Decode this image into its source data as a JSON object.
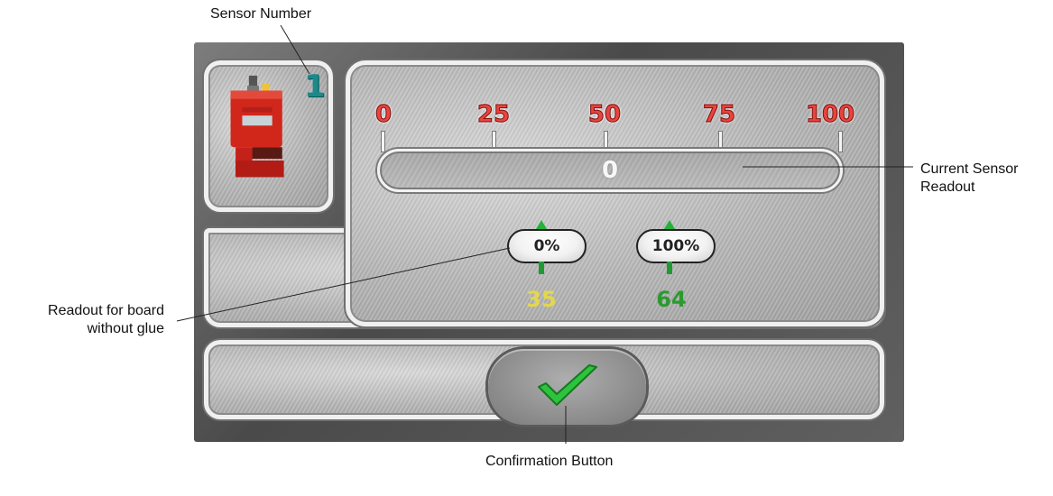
{
  "annotations": {
    "sensor_number": "Sensor Number",
    "current_readout": "Current Sensor\nReadout",
    "readout_no_glue": "Readout for board\nwithout glue",
    "confirm_button": "Confirmation Button"
  },
  "sensor": {
    "number": "1",
    "icon": "sensor-device-icon"
  },
  "scale": {
    "ticks": [
      "0",
      "25",
      "50",
      "75",
      "100"
    ]
  },
  "current_readout": "0",
  "calibration": {
    "low": {
      "label": "0%",
      "value": "35",
      "color": "#e3d74b"
    },
    "high": {
      "label": "100%",
      "value": "64",
      "color": "#2a9a2e"
    }
  },
  "confirm": {
    "icon": "checkmark-icon"
  },
  "colors": {
    "tick": "#e8453d",
    "sensor_number": "#1a8a8a",
    "arrow": "#23b23a"
  }
}
